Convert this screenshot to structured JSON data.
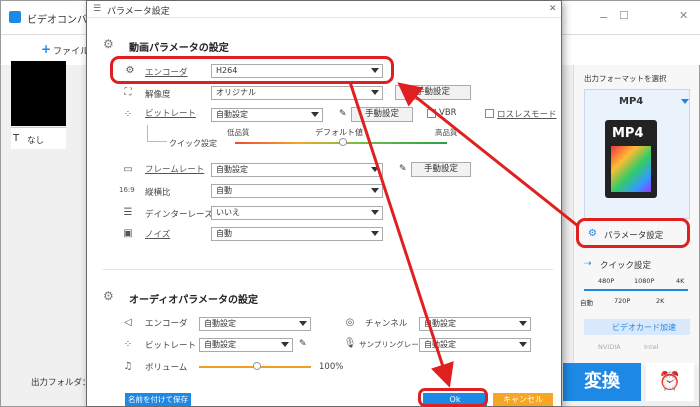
{
  "background": {
    "app_title": "ビデオコンバ",
    "add_file": "ファイル",
    "list_item": "なし",
    "output_folder": "出力フォルダ：",
    "convert": "変換",
    "right": {
      "select_format": "出力フォーマットを選択",
      "format": "MP4",
      "format_icon_text": "MP4",
      "param_settings": "パラメータ設定",
      "quick_settings": "クイック設定",
      "res_top": [
        "480P",
        "1080P",
        "4K"
      ],
      "res_bottom": [
        "自動",
        "720P",
        "2K"
      ],
      "gpu_accel": "ビデオカード加速",
      "gpu_brands": [
        "NVIDIA",
        "Intel"
      ]
    }
  },
  "dialog": {
    "title": "パラメータ設定",
    "video_section": "動画パラメータの設定",
    "audio_section": "オーディオパラメータの設定",
    "video": {
      "encoder_label": "エンコーダ",
      "encoder_value": "H264",
      "resolution_label": "解像度",
      "resolution_value": "オリジナル",
      "bitrate_label": "ビットレート",
      "bitrate_value": "自動設定",
      "vbr": "VBR",
      "lossless": "ロスレスモード",
      "quick_settings": "クイック設定",
      "low_quality": "低品質",
      "default_value": "デフォルト値",
      "high_quality": "高品質",
      "framerate_label": "フレームレート",
      "framerate_value": "自動設定",
      "aspect_label": "縦横比",
      "aspect_value": "自動",
      "deinterlace_label": "デインターレース",
      "deinterlace_value": "いいえ",
      "volume_label": "ノイズ",
      "volume_value": "自動",
      "manual": "手動設定"
    },
    "audio": {
      "encoder_label": "エンコーダ",
      "encoder_value": "自動設定",
      "channel_label": "チャンネル",
      "channel_value": "自動設定",
      "bitrate_label": "ビットレート",
      "bitrate_value": "自動設定",
      "sample_label": "サンプリングレート",
      "sample_value": "自動設定",
      "volume_label": "ボリューム",
      "volume_value": "100%"
    },
    "save_as": "名前を付けて保存",
    "ok": "Ok",
    "cancel": "キャンセル"
  },
  "colors": {
    "accent": "#1e88e5",
    "annotation": "#e02020",
    "cancel": "#f5a623"
  }
}
